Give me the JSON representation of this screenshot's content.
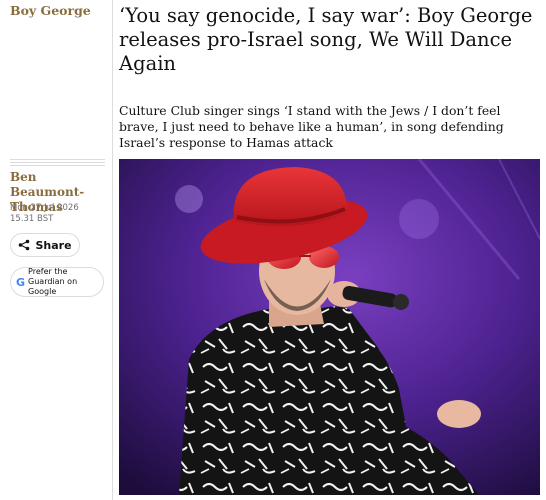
{
  "section": {
    "kicker": "Boy George"
  },
  "article": {
    "headline": "‘You say genocide, I say war’: Boy George releases pro-Israel song, We Will Dance Again",
    "standfirst": "Culture Club singer sings ‘I stand with the Jews / I don’t feel brave, I just need to behave like a human’, in song defending Israel’s response to Hamas attack"
  },
  "meta": {
    "author": "Ben Beaumont-Thomas",
    "date": "Mon 27 Jul 2026 15.31 BST"
  },
  "actions": {
    "share_label": "Share",
    "prefer_label": "Prefer the Guardian on Google",
    "share_icon": "share-icon",
    "google_icon": "google-g-icon"
  },
  "colors": {
    "accent": "#8a6c3e",
    "stage_purple": "#5b2ba0",
    "hat_red": "#d9222a"
  }
}
